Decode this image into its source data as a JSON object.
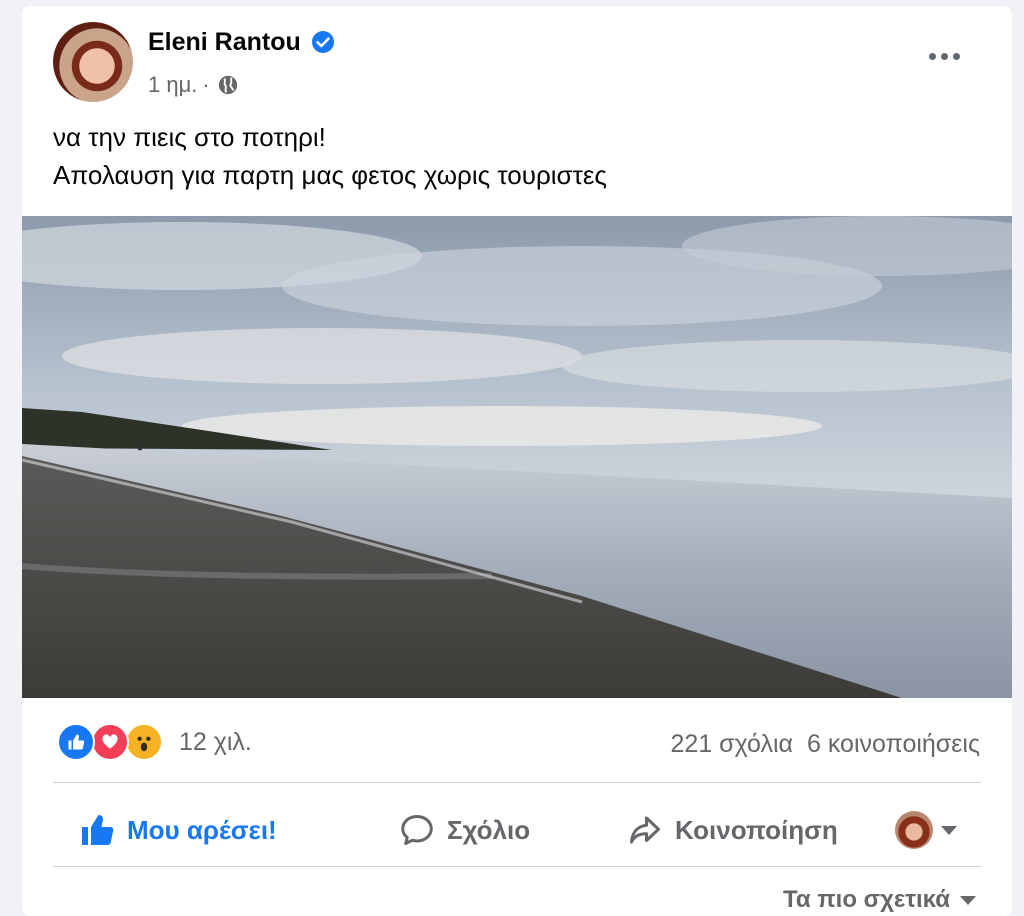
{
  "post": {
    "author": "Eleni Rantou",
    "time": "1 ημ.",
    "separator": "·",
    "text_lines": [
      "να την πιεις στο ποτηρι!",
      "Απολαυση για παρτη μας φετος χωρις τουριστες"
    ],
    "reactions_count": "12 χιλ.",
    "comments": "221 σχόλια",
    "shares": "6 κοινοποιήσεις"
  },
  "actions": {
    "like": "Μου αρέσει!",
    "comment": "Σχόλιο",
    "share": "Κοινοποίηση"
  },
  "comment_sort": "Τα πιο σχετικά",
  "colors": {
    "accent": "#1877f2",
    "secondary_text": "#65676b",
    "love": "#f33e58",
    "wow": "#f7b125"
  },
  "icons": [
    "verified-badge-icon",
    "globe-icon",
    "more-options-icon",
    "like-reaction-icon",
    "love-reaction-icon",
    "wow-reaction-icon",
    "thumbs-up-icon",
    "comment-icon",
    "share-icon",
    "chevron-down-icon"
  ]
}
